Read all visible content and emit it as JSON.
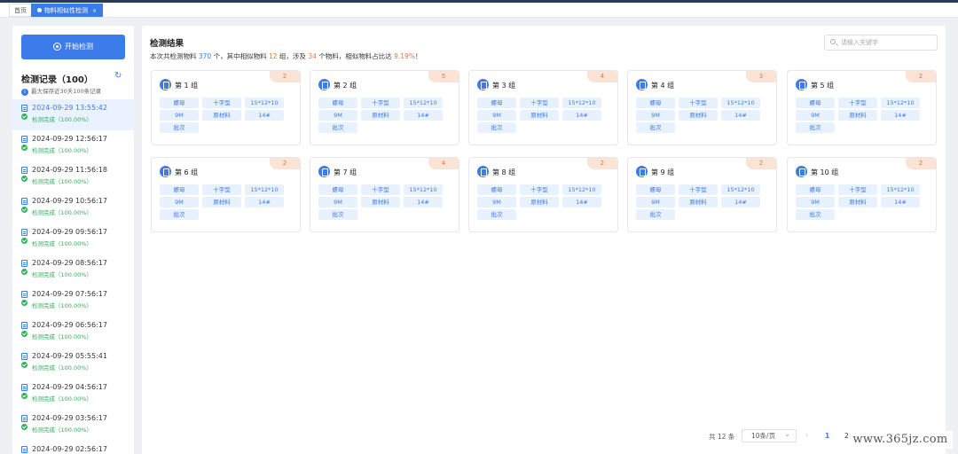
{
  "tabs": [
    {
      "label": "首页",
      "active": false
    },
    {
      "label": "物料相似性检测",
      "close": "×",
      "active": true
    }
  ],
  "sidebar": {
    "start_label": "开始检测",
    "records_title": "检测记录（100）",
    "records_note": "最大保存近30天100条记录",
    "records": [
      {
        "time": "2024-09-29 13:55:42",
        "status": "检测完成（100.00%）",
        "selected": true
      },
      {
        "time": "2024-09-29 12:56:17",
        "status": "检测完成（100.00%）"
      },
      {
        "time": "2024-09-29 11:56:18",
        "status": "检测完成（100.00%）"
      },
      {
        "time": "2024-09-29 10:56:17",
        "status": "检测完成（100.00%）"
      },
      {
        "time": "2024-09-29 09:56:17",
        "status": "检测完成（100.00%）"
      },
      {
        "time": "2024-09-29 08:56:17",
        "status": "检测完成（100.00%）"
      },
      {
        "time": "2024-09-29 07:56:17",
        "status": "检测完成（100.00%）"
      },
      {
        "time": "2024-09-29 06:56:17",
        "status": "检测完成（100.00%）"
      },
      {
        "time": "2024-09-29 05:55:41",
        "status": "检测完成（100.00%）"
      },
      {
        "time": "2024-09-29 04:56:17",
        "status": "检测完成（100.00%）"
      },
      {
        "time": "2024-09-29 03:56:17",
        "status": "检测完成（100.00%）"
      },
      {
        "time": "2024-09-29 02:56:17",
        "status": ""
      }
    ]
  },
  "main": {
    "title": "检测结果",
    "summary": {
      "p1": "本次共检测物料 ",
      "total": "370",
      "p2": " 个，其中相似物料 ",
      "groups": "12",
      "p3": " 组，涉及 ",
      "involved": "34",
      "p4": " 个物料，相似物料占比达 ",
      "ratio": "9.19%",
      "p5": "！"
    },
    "search_placeholder": "请输入关键字",
    "cards": [
      {
        "name": "第 1 组",
        "count": "2"
      },
      {
        "name": "第 2 组",
        "count": "5"
      },
      {
        "name": "第 3 组",
        "count": "4"
      },
      {
        "name": "第 4 组",
        "count": "3"
      },
      {
        "name": "第 5 组",
        "count": "2"
      },
      {
        "name": "第 6 组",
        "count": "2"
      },
      {
        "name": "第 7 组",
        "count": "4"
      },
      {
        "name": "第 8 组",
        "count": "2"
      },
      {
        "name": "第 9 组",
        "count": "2"
      },
      {
        "name": "第 10 组",
        "count": "2"
      }
    ],
    "tags": [
      "螺母",
      "十字型",
      "15*12*10",
      "9M",
      "原材料",
      "14#",
      "批次"
    ]
  },
  "pagination": {
    "total": "共 12 条",
    "page_size": "10条/页",
    "prev": "‹",
    "pages": [
      "1",
      "2"
    ]
  },
  "watermark": "www.365jz.com",
  "colors": {
    "accent": "#3e7bea",
    "highlight": "#e8773a",
    "success": "#2fae5c",
    "badge_bg": "#fbe3d6"
  }
}
